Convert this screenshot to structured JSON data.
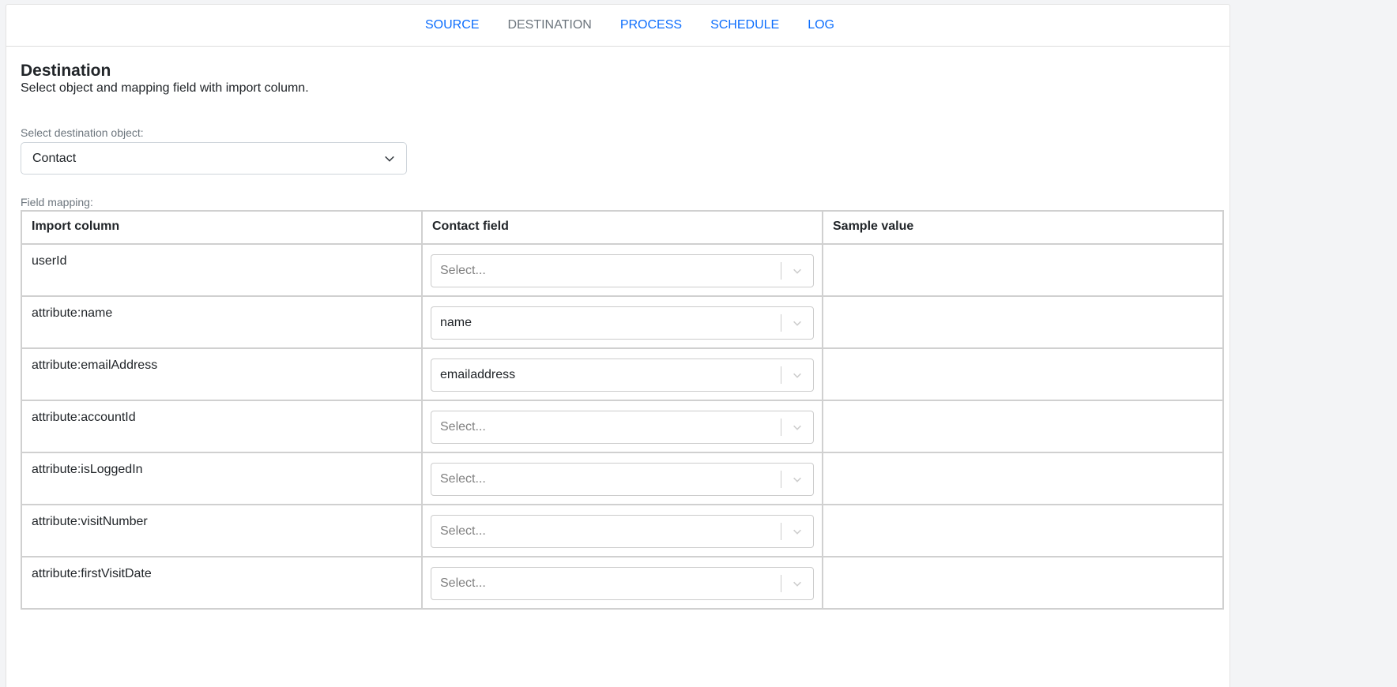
{
  "nav": {
    "items": [
      {
        "label": "SOURCE",
        "active": false
      },
      {
        "label": "DESTINATION",
        "active": true
      },
      {
        "label": "PROCESS",
        "active": false
      },
      {
        "label": "SCHEDULE",
        "active": false
      },
      {
        "label": "LOG",
        "active": false
      }
    ]
  },
  "page": {
    "title": "Destination",
    "subtitle": "Select object and mapping field with import column."
  },
  "destination": {
    "label": "Select destination object:",
    "value": "Contact"
  },
  "mapping": {
    "label": "Field mapping:",
    "headers": [
      "Import column",
      "Contact field",
      "Sample value"
    ],
    "placeholder": "Select...",
    "rows": [
      {
        "column": "userId",
        "field": "",
        "sample": ""
      },
      {
        "column": "attribute:name",
        "field": "name",
        "sample": ""
      },
      {
        "column": "attribute:emailAddress",
        "field": "emailaddress",
        "sample": ""
      },
      {
        "column": "attribute:accountId",
        "field": "",
        "sample": ""
      },
      {
        "column": "attribute:isLoggedIn",
        "field": "",
        "sample": ""
      },
      {
        "column": "attribute:visitNumber",
        "field": "",
        "sample": ""
      },
      {
        "column": "attribute:firstVisitDate",
        "field": "",
        "sample": ""
      }
    ]
  },
  "colors": {
    "link": "#0d6efd",
    "active": "#6c757d"
  }
}
